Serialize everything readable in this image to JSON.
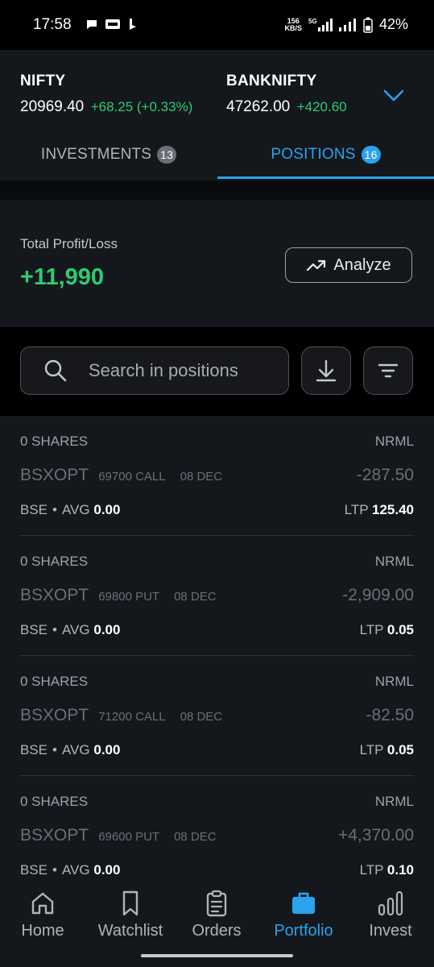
{
  "status_bar": {
    "time": "17:58",
    "speed_top": "156",
    "speed_bottom": "KB/S",
    "network": "5G",
    "battery": "42%"
  },
  "market": {
    "indices": [
      {
        "name": "NIFTY",
        "price": "20969.40",
        "change": "+68.25 (+0.33%)"
      },
      {
        "name": "BANKNIFTY",
        "price": "47262.00",
        "change": "+420.60"
      }
    ]
  },
  "tabs": [
    {
      "label": "INVESTMENTS",
      "count": "13"
    },
    {
      "label": "POSITIONS",
      "count": "16"
    }
  ],
  "summary": {
    "label": "Total Profit/Loss",
    "value": "+11,990",
    "analyze_label": "Analyze"
  },
  "search": {
    "placeholder": "Search in positions"
  },
  "positions": [
    {
      "qty": "0 SHARES",
      "product": "NRML",
      "symbol": "BSXOPT",
      "strike": "69700 CALL",
      "expiry": "08 DEC",
      "pnl": "-287.50",
      "exchange": "BSE",
      "avg_label": "AVG",
      "avg": "0.00",
      "ltp_label": "LTP",
      "ltp": "125.40"
    },
    {
      "qty": "0 SHARES",
      "product": "NRML",
      "symbol": "BSXOPT",
      "strike": "69800 PUT",
      "expiry": "08 DEC",
      "pnl": "-2,909.00",
      "exchange": "BSE",
      "avg_label": "AVG",
      "avg": "0.00",
      "ltp_label": "LTP",
      "ltp": "0.05"
    },
    {
      "qty": "0 SHARES",
      "product": "NRML",
      "symbol": "BSXOPT",
      "strike": "71200 CALL",
      "expiry": "08 DEC",
      "pnl": "-82.50",
      "exchange": "BSE",
      "avg_label": "AVG",
      "avg": "0.00",
      "ltp_label": "LTP",
      "ltp": "0.05"
    },
    {
      "qty": "0 SHARES",
      "product": "NRML",
      "symbol": "BSXOPT",
      "strike": "69600 PUT",
      "expiry": "08 DEC",
      "pnl": "+4,370.00",
      "exchange": "BSE",
      "avg_label": "AVG",
      "avg": "0.00",
      "ltp_label": "LTP",
      "ltp": "0.10"
    }
  ],
  "nav": [
    {
      "label": "Home",
      "icon": "home-icon"
    },
    {
      "label": "Watchlist",
      "icon": "bookmark-icon"
    },
    {
      "label": "Orders",
      "icon": "clipboard-icon"
    },
    {
      "label": "Portfolio",
      "icon": "briefcase-icon",
      "active": true
    },
    {
      "label": "Invest",
      "icon": "bar-chart-icon"
    }
  ],
  "colors": {
    "accent": "#2aa2ee",
    "profit": "#2ecc71",
    "background": "#14171c"
  }
}
